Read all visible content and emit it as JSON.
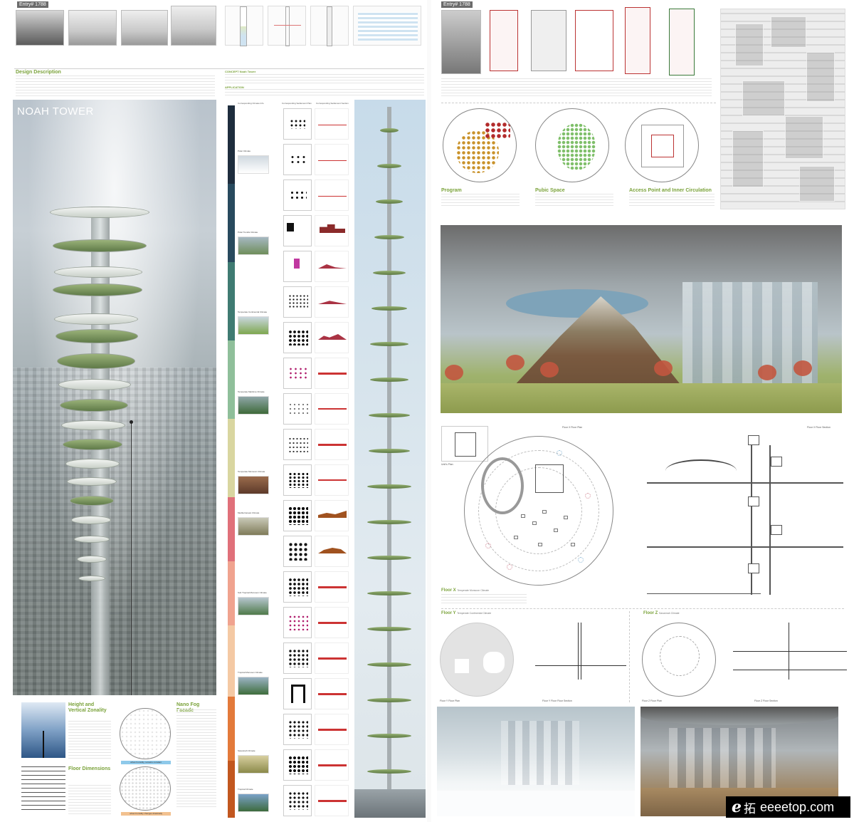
{
  "left_board": {
    "entry_label": "Entry# 1788",
    "title": "NOAH TOWER",
    "description_heading": "Design Description",
    "concept_heading": "CONCEPT  Noah Tower",
    "application_heading": "APPLICATION",
    "climate_column_headings": [
      "Corresponding Climate Info",
      "Corresponding Settlement Plan",
      "Corresponding Settlement Section"
    ],
    "bottom_panels": {
      "height_heading": "Height and Vertical Zonality",
      "floor_heading": "Floor Dimensions",
      "nano_heading": "Nano Fog Facade",
      "chip_top": "urban humidity, remains constant",
      "chip_bottom": "urban humidity changes drastically"
    },
    "climates": [
      "Polar Climate",
      "Polar Tundra Climate",
      "Temperate Continental Climate",
      "Temperate Maritime Climate",
      "Temperate Monsoon Climate",
      "Mediterranean Climate",
      "Sub Tropical Monsoon Climate",
      "Tropical Monsoon Climate",
      "Savannah Climate",
      "Tropical Climate"
    ]
  },
  "right_board": {
    "entry_label": "Entry# 1788",
    "program_heading": "Program",
    "public_space_heading": "Pubic Space",
    "access_heading": "Access Point and Inner Circulation",
    "floor_x_plan_label": "Floor X Floor Plan",
    "floor_x_section_label": "Floor X Floor Section",
    "unit_plan_label": "Unit's Plan",
    "floor_x_heading": "Floor X",
    "floor_x_sub": "Temperate Monsoon Climate",
    "floor_y_heading": "Floor Y",
    "floor_y_sub": "Temperate Continental Climate",
    "floor_z_heading": "Floor Z",
    "floor_z_sub": "Savannah Climate",
    "floor_y_plan_label": "Floor Y Floor Plan",
    "floor_y_section_label": "Floor Y Floor Floor Section",
    "floor_z_plan_label": "Floor Z Floor Plan",
    "floor_z_section_label": "Floor Z Floor Section"
  },
  "watermark": {
    "logo": "e",
    "cn": "拓",
    "url": "eeeetop.com"
  },
  "colors": {
    "accent_green": "#7aa23a",
    "plan_red": "#b33333",
    "watermark_bg": "#000000"
  }
}
